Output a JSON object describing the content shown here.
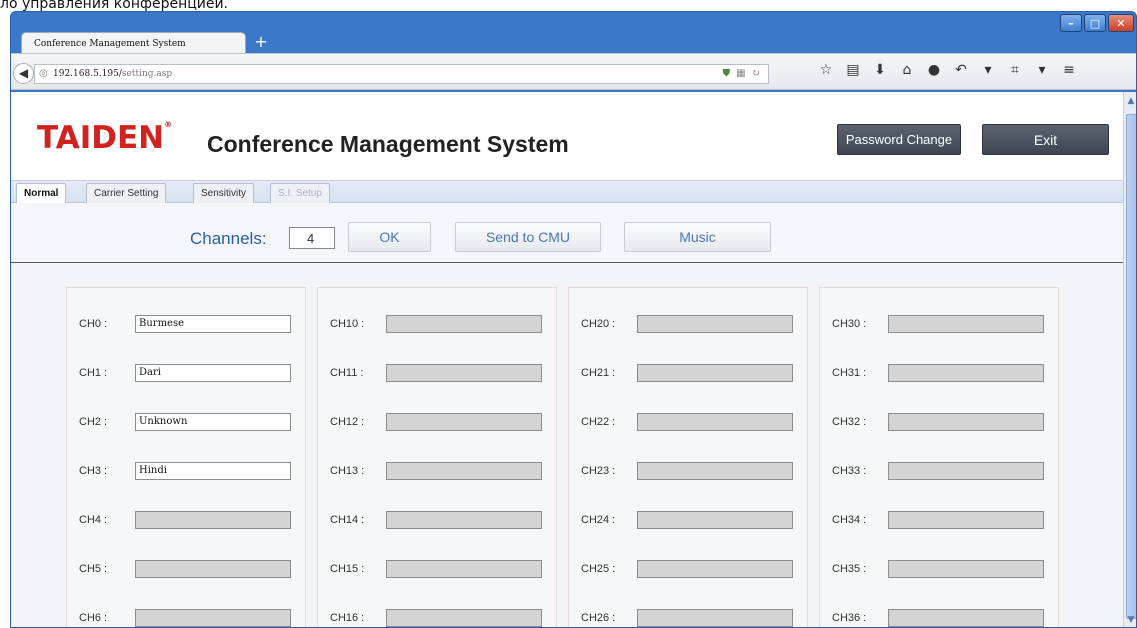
{
  "caption": "ло управления конференцией.",
  "browser": {
    "tab_title": "Conference Management System",
    "new_tab": "+",
    "url_host": "192.168.5.195/",
    "url_path": "setting.asp",
    "window_controls": [
      "minimize",
      "maximize",
      "close"
    ]
  },
  "header": {
    "logo": "TAIDEN",
    "logo_mark": "®",
    "title": "Conference Management System",
    "password_button": "Password Change",
    "exit_button": "Exit"
  },
  "tabs": [
    {
      "label": "Normal",
      "state": "active"
    },
    {
      "label": "Carrier Setting",
      "state": "normal"
    },
    {
      "label": "Sensitivity",
      "state": "normal"
    },
    {
      "label": "S.I. Setup",
      "state": "disabled"
    }
  ],
  "toolbar": {
    "channels_label": "Channels:",
    "channels_value": "4",
    "ok_label": "OK",
    "send_label": "Send to CMU",
    "music_label": "Music"
  },
  "channel_columns": [
    [
      {
        "label": "CH0 :",
        "value": "Burmese"
      },
      {
        "label": "CH1 :",
        "value": "Dari"
      },
      {
        "label": "CH2 :",
        "value": "Unknown"
      },
      {
        "label": "CH3 :",
        "value": "Hindi"
      },
      {
        "label": "CH4 :",
        "value": ""
      },
      {
        "label": "CH5 :",
        "value": ""
      },
      {
        "label": "CH6 :",
        "value": ""
      }
    ],
    [
      {
        "label": "CH10 :",
        "value": ""
      },
      {
        "label": "CH11 :",
        "value": ""
      },
      {
        "label": "CH12 :",
        "value": ""
      },
      {
        "label": "CH13 :",
        "value": ""
      },
      {
        "label": "CH14 :",
        "value": ""
      },
      {
        "label": "CH15 :",
        "value": ""
      },
      {
        "label": "CH16 :",
        "value": ""
      }
    ],
    [
      {
        "label": "CH20 :",
        "value": ""
      },
      {
        "label": "CH21 :",
        "value": ""
      },
      {
        "label": "CH22 :",
        "value": ""
      },
      {
        "label": "CH23 :",
        "value": ""
      },
      {
        "label": "CH24 :",
        "value": ""
      },
      {
        "label": "CH25 :",
        "value": ""
      },
      {
        "label": "CH26 :",
        "value": ""
      }
    ],
    [
      {
        "label": "CH30 :",
        "value": ""
      },
      {
        "label": "CH31 :",
        "value": ""
      },
      {
        "label": "CH32 :",
        "value": ""
      },
      {
        "label": "CH33 :",
        "value": ""
      },
      {
        "label": "CH34 :",
        "value": ""
      },
      {
        "label": "CH35 :",
        "value": ""
      },
      {
        "label": "CH36 :",
        "value": ""
      }
    ]
  ],
  "colors": {
    "brand_red": "#d0231f",
    "accent_blue": "#2a5fa8",
    "header_button": "#4a515d"
  }
}
